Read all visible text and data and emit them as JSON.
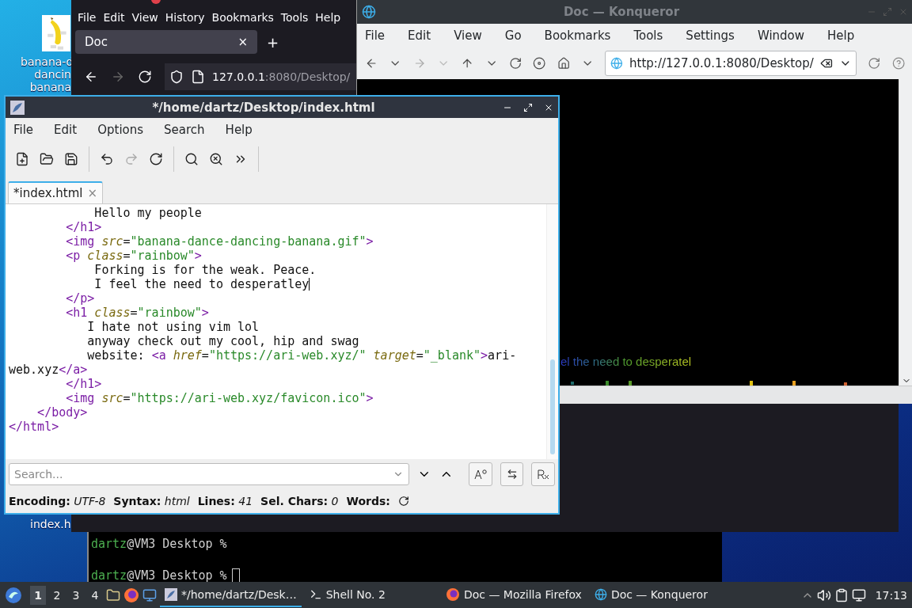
{
  "desktop_icons": [
    {
      "label_lines": [
        "banana-d",
        "dancin",
        "banana"
      ]
    },
    {
      "label_lines": [
        "index.h"
      ]
    }
  ],
  "firefox": {
    "menu": [
      "File",
      "Edit",
      "View",
      "History",
      "Bookmarks",
      "Tools",
      "Help"
    ],
    "tabs": [
      {
        "label": "Doc",
        "close": "×",
        "selected": true
      }
    ],
    "new_tab": "+",
    "url_host": "127.0.0.1",
    "url_rest": ":8080/Desktop/"
  },
  "konqueror": {
    "title": "Doc — Konqueror",
    "menu": [
      "File",
      "Edit",
      "View",
      "Go",
      "Bookmarks",
      "Tools",
      "Settings",
      "Window",
      "Help"
    ],
    "url": "http://127.0.0.1:8080/Desktop/",
    "page_text": "el the need to desperatel"
  },
  "editor": {
    "title": "*/home/dartz/Desktop/index.html",
    "menu": [
      "File",
      "Edit",
      "Options",
      "Search",
      "Help"
    ],
    "tabs": [
      {
        "label": "*index.html",
        "close": "×",
        "selected": true
      }
    ],
    "lines": [
      {
        "tokens": [
          {
            "kind": "text",
            "text": "            Hello my people"
          }
        ]
      },
      {
        "tokens": [
          {
            "kind": "tag",
            "text": "        </h1>"
          }
        ]
      },
      {
        "tokens": [
          {
            "kind": "tag",
            "text": "        <img"
          },
          {
            "kind": "attr",
            "text": " src"
          },
          {
            "kind": "text",
            "text": "="
          },
          {
            "kind": "string",
            "text": "\"banana-dance-dancing-banana.gif\""
          },
          {
            "kind": "tag",
            "text": ">"
          }
        ]
      },
      {
        "tokens": [
          {
            "kind": "tag",
            "text": "        <p"
          },
          {
            "kind": "attr",
            "text": " class"
          },
          {
            "kind": "text",
            "text": "="
          },
          {
            "kind": "string",
            "text": "\"rainbow\""
          },
          {
            "kind": "tag",
            "text": ">"
          }
        ]
      },
      {
        "tokens": [
          {
            "kind": "text",
            "text": "            Forking is for the weak. Peace."
          }
        ]
      },
      {
        "tokens": [
          {
            "kind": "text",
            "text": "            I feel the need to desperatley"
          }
        ],
        "caret": true
      },
      {
        "tokens": [
          {
            "kind": "tag",
            "text": "        </p>"
          }
        ]
      },
      {
        "tokens": [
          {
            "kind": "tag",
            "text": "        <h1"
          },
          {
            "kind": "attr",
            "text": " class"
          },
          {
            "kind": "text",
            "text": "="
          },
          {
            "kind": "string",
            "text": "\"rainbow\""
          },
          {
            "kind": "tag",
            "text": ">"
          }
        ]
      },
      {
        "tokens": [
          {
            "kind": "text",
            "text": "           I hate not using vim lol"
          }
        ]
      },
      {
        "tokens": [
          {
            "kind": "text",
            "text": "           anyway check out my cool, hip and swag"
          }
        ]
      },
      {
        "tokens": [
          {
            "kind": "text",
            "text": "           website: "
          },
          {
            "kind": "tag",
            "text": "<a"
          },
          {
            "kind": "attr",
            "text": " href"
          },
          {
            "kind": "text",
            "text": "="
          },
          {
            "kind": "string",
            "text": "\"https://ari-web.xyz/\""
          },
          {
            "kind": "attr",
            "text": " target"
          },
          {
            "kind": "text",
            "text": "="
          },
          {
            "kind": "string",
            "text": "\"_blank\""
          },
          {
            "kind": "tag",
            "text": ">"
          },
          {
            "kind": "text",
            "text": "ari-"
          }
        ]
      },
      {
        "tokens": [
          {
            "kind": "text",
            "text": "web.xyz"
          },
          {
            "kind": "tag",
            "text": "</a>"
          }
        ]
      },
      {
        "tokens": [
          {
            "kind": "tag",
            "text": "        </h1>"
          }
        ]
      },
      {
        "tokens": [
          {
            "kind": "tag",
            "text": "        <img"
          },
          {
            "kind": "attr",
            "text": " src"
          },
          {
            "kind": "text",
            "text": "="
          },
          {
            "kind": "string",
            "text": "\"https://ari-web.xyz/favicon.ico\""
          },
          {
            "kind": "tag",
            "text": ">"
          }
        ]
      },
      {
        "tokens": [
          {
            "kind": "tag",
            "text": "    </body>"
          }
        ]
      },
      {
        "tokens": [
          {
            "kind": "tag",
            "text": "</html>"
          }
        ]
      }
    ],
    "search_placeholder": "Search...",
    "status": [
      {
        "label": "Encoding:",
        "value": "UTF-8"
      },
      {
        "label": "Syntax:",
        "value": "html"
      },
      {
        "label": "Lines:",
        "value": "41"
      },
      {
        "label": "Sel. Chars:",
        "value": "0"
      },
      {
        "label": "Words:"
      }
    ]
  },
  "terminal": {
    "lines": [
      {
        "user": "dartz",
        "rest": "@VM3 Desktop %",
        "cursor": false
      },
      {
        "user": "dartz",
        "rest": "@VM3 Desktop %",
        "cursor": true
      }
    ]
  },
  "taskbar": {
    "workspaces": [
      {
        "label": "1",
        "selected": true
      },
      {
        "label": "2",
        "selected": false
      },
      {
        "label": "3",
        "selected": false
      },
      {
        "label": "4",
        "selected": false
      }
    ],
    "tasks": [
      {
        "kind": "editor",
        "label": "*/home/dartz/Desk…",
        "selected": true
      },
      {
        "kind": "shell",
        "label": "Shell No. 2",
        "selected": false
      },
      {
        "kind": "firefox",
        "label": "Doc — Mozilla Firefox",
        "selected": false
      },
      {
        "kind": "konqueror",
        "label": "Doc — Konqueror",
        "selected": false
      }
    ],
    "clock": "17:13"
  }
}
